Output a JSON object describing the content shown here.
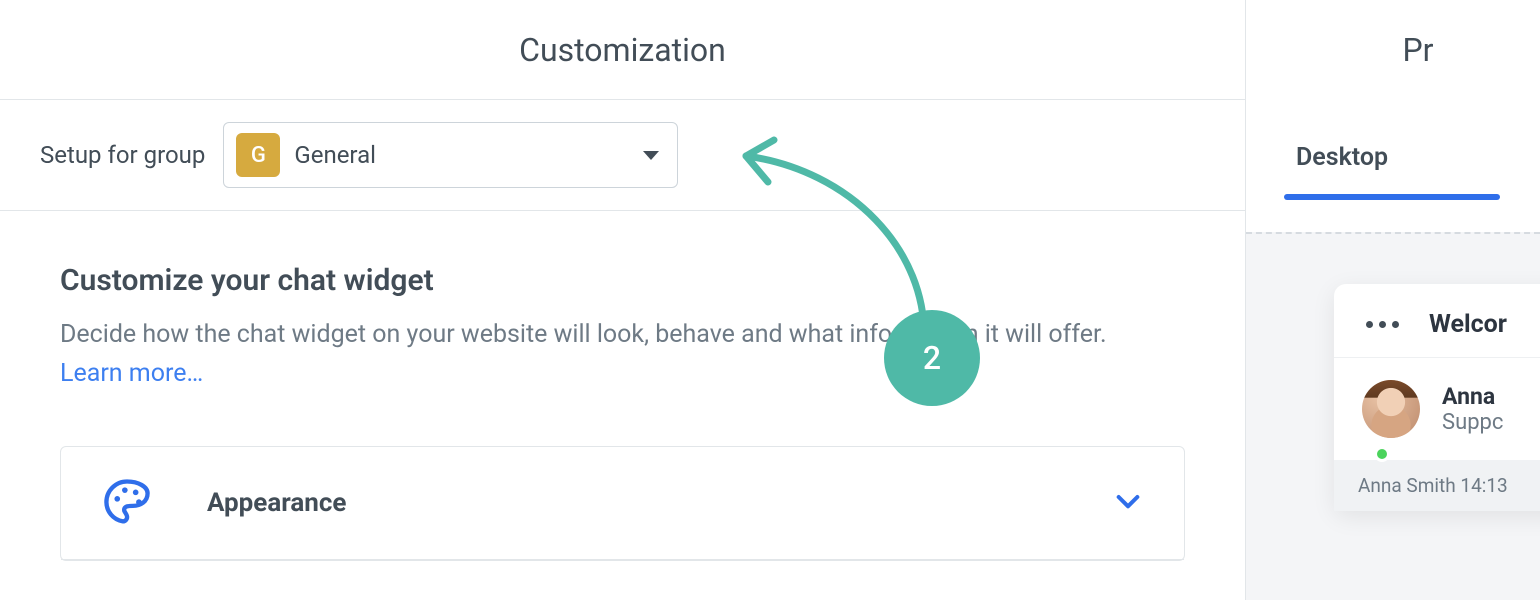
{
  "header": {
    "title": "Customization",
    "right_title": "Pr"
  },
  "group": {
    "label": "Setup for group",
    "badge_letter": "G",
    "selected": "General"
  },
  "section": {
    "title": "Customize your chat widget",
    "description": "Decide how the chat widget on your website will look, behave and what information it will offer. ",
    "learn_more": "Learn more…"
  },
  "accordion": {
    "appearance": "Appearance"
  },
  "tabs": {
    "desktop": "Desktop"
  },
  "chat": {
    "welcome": "Welcor",
    "agent_name": "Anna",
    "agent_role": "Suppc",
    "timestamp_line": "Anna Smith 14:13"
  },
  "annotation": {
    "step": "2"
  }
}
